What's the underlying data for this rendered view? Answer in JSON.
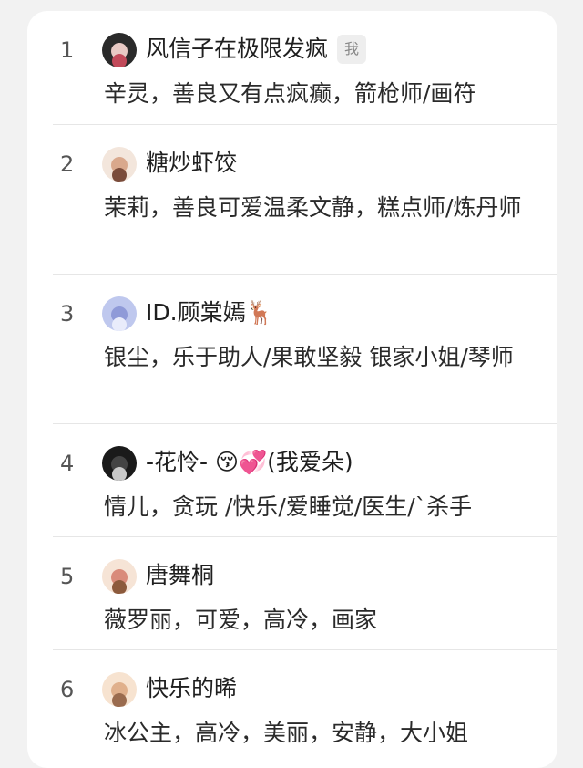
{
  "list": [
    {
      "rank": "1",
      "name": "风信子在极限发疯",
      "badge": "我",
      "desc": "辛灵，善良又有点疯癫，箭枪师/画符",
      "avatar_colors": [
        "#2a2a2a",
        "#e8c9c4",
        "#c24a5a"
      ]
    },
    {
      "rank": "2",
      "name": "糖炒虾饺",
      "desc": "茉莉，善良可爱温柔文静，糕点师/炼丹师",
      "avatar_colors": [
        "#f3e6dc",
        "#d9a88c",
        "#7a4c3b"
      ]
    },
    {
      "rank": "3",
      "name": "ID.顾棠嫣🦌",
      "desc": "银尘，乐于助人/果敢坚毅 银家小姐/琴师",
      "avatar_colors": [
        "#bfc8ee",
        "#8f9ad8",
        "#e9ecfb"
      ]
    },
    {
      "rank": "4",
      "name": "-花怜- 😚💞(我爱朵)",
      "desc": "情儿，贪玩 /快乐/爱睡觉/医生/`杀手",
      "avatar_colors": [
        "#1a1a1a",
        "#444444",
        "#c9c9c9"
      ]
    },
    {
      "rank": "5",
      "name": "唐舞桐",
      "desc": "薇罗丽，可爱，高冷，画家",
      "avatar_colors": [
        "#f6e4d6",
        "#d98b7a",
        "#8c5a3c"
      ]
    },
    {
      "rank": "6",
      "name": "快乐的晞",
      "desc": "冰公主，高冷，美丽，安静，大小姐",
      "avatar_colors": [
        "#f7e3d0",
        "#e0b08c",
        "#9a6b4e"
      ]
    }
  ]
}
